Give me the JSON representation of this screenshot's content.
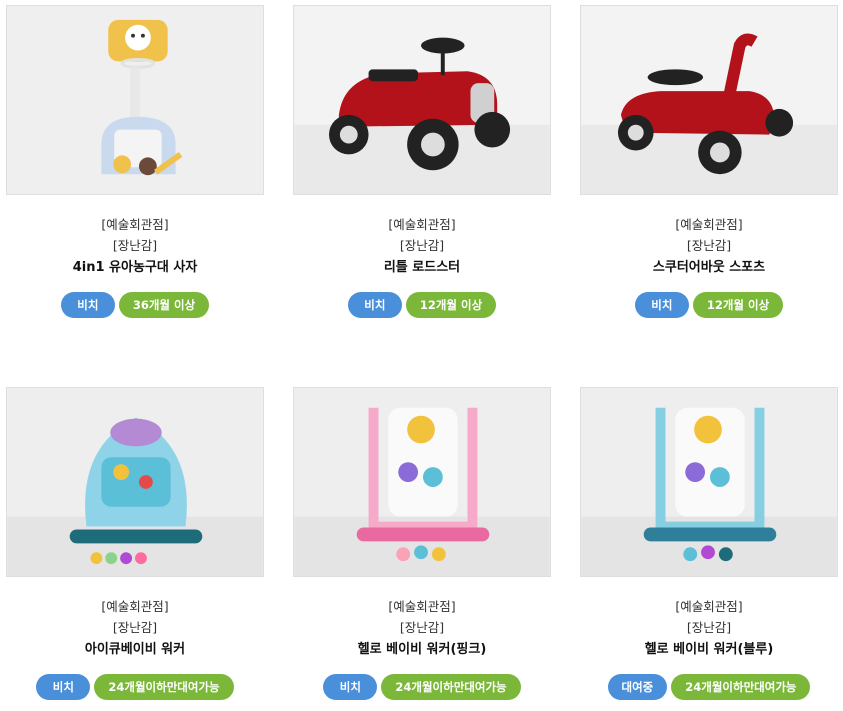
{
  "products": [
    {
      "store": "[예술회관점]",
      "category": "[장난감]",
      "name": "4in1 유아농구대 사자",
      "status": "비치",
      "age": "36개월 이상",
      "image": "basketball-hoop-lion"
    },
    {
      "store": "[예술회관점]",
      "category": "[장난감]",
      "name": "리틀 로드스터",
      "status": "비치",
      "age": "12개월 이상",
      "image": "red-roadster-ride-on"
    },
    {
      "store": "[예술회관점]",
      "category": "[장난감]",
      "name": "스쿠터어바웃 스포츠",
      "status": "비치",
      "age": "12개월 이상",
      "image": "red-scooter-ride-on"
    },
    {
      "store": "[예술회관점]",
      "category": "[장난감]",
      "name": "아이큐베이비 워커",
      "status": "비치",
      "age": "24개월이하만대여가능",
      "image": "blue-owl-walker"
    },
    {
      "store": "[예술회관점]",
      "category": "[장난감]",
      "name": "헬로 베이비 워커(핑크)",
      "status": "비치",
      "age": "24개월이하만대여가능",
      "image": "pink-baby-walker"
    },
    {
      "store": "[예술회관점]",
      "category": "[장난감]",
      "name": "헬로 베이비 워커(블루)",
      "status": "대여중",
      "age": "24개월이하만대여가능",
      "image": "blue-baby-walker"
    }
  ],
  "colors": {
    "status_badge": "#4a8fd9",
    "age_badge": "#7bb83a"
  }
}
